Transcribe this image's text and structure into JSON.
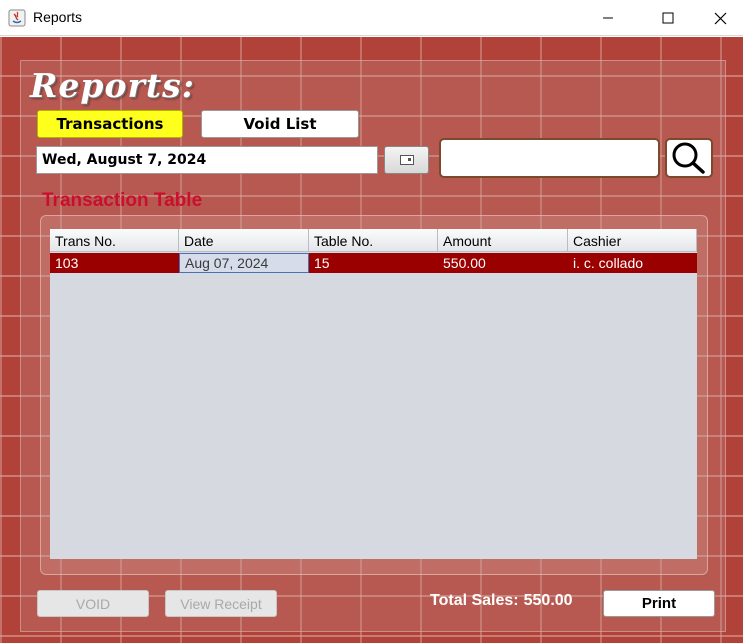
{
  "window": {
    "title": "Reports",
    "icons": {
      "app": "java-app-icon",
      "minimize": "minimize-icon",
      "maximize": "maximize-icon",
      "close": "close-icon"
    }
  },
  "header": {
    "title": "Reports:"
  },
  "tabs": [
    {
      "label": "Transactions",
      "active": true
    },
    {
      "label": "Void List",
      "active": false
    }
  ],
  "filters": {
    "date_value": "Wed, August 7, 2024",
    "calendar_icon": "calendar-icon",
    "search_value": "",
    "search_icon": "magnifier-icon"
  },
  "section": {
    "title": "Transaction Table"
  },
  "table": {
    "columns": [
      "Trans No.",
      "Date",
      "Table No.",
      "Amount",
      "Cashier"
    ],
    "rows": [
      [
        "103",
        "Aug 07, 2024",
        "15",
        "550.00",
        "i. c. collado"
      ]
    ]
  },
  "footer": {
    "void_label": "VOID",
    "view_receipt_label": "View Receipt",
    "total_label": "Total Sales:",
    "total_value": "550.00",
    "print_label": "Print"
  },
  "colors": {
    "accent_yellow": "#ffff1e",
    "section_red": "#c8102e",
    "selected_row": "#9b0000",
    "brick": "#b0423a"
  }
}
